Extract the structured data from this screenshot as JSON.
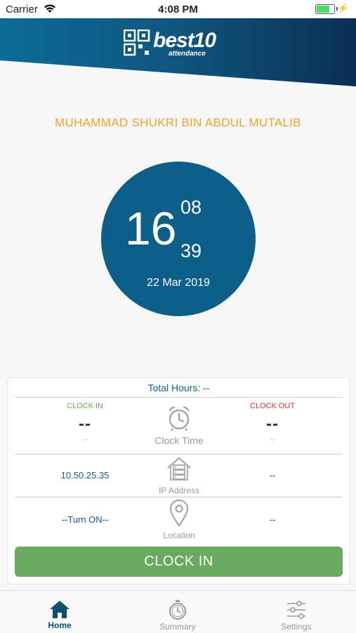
{
  "status_bar": {
    "carrier": "Carrier",
    "time": "4:08 PM"
  },
  "app": {
    "logo_main": "best10",
    "logo_sub": "attendance",
    "brand_color": "#0d5e88"
  },
  "user": {
    "name": "MUHAMMAD SHUKRI BIN ABDUL MUTALIB"
  },
  "clock": {
    "hour": "16",
    "minute": "08",
    "second": "39",
    "date": "22 Mar 2019"
  },
  "summary": {
    "total_hours": "Total Hours: --",
    "clock_in": {
      "label": "CLOCK IN",
      "time": "--",
      "sub": "--"
    },
    "clock_out": {
      "label": "CLOCK OUT",
      "time": "--",
      "sub": "--"
    },
    "clock_time_label": "Clock Time",
    "ip": {
      "label": "IP Address",
      "in_value": "10.50.25.35",
      "out_value": "--"
    },
    "location": {
      "label": "Location",
      "in_value": "--Turn ON--",
      "out_value": "--"
    }
  },
  "clock_in_button": "CLOCK IN",
  "tabs": [
    {
      "label": "Home",
      "icon": "home-icon",
      "active": true
    },
    {
      "label": "Summary",
      "icon": "stopwatch-icon",
      "active": false
    },
    {
      "label": "Settings",
      "icon": "sliders-icon",
      "active": false
    }
  ],
  "colors": {
    "accent_orange": "#f0a22a",
    "green": "#6aaa5e",
    "red": "#d0342c"
  }
}
